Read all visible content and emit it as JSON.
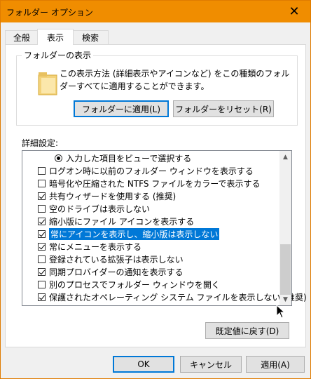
{
  "window": {
    "title": "フォルダー オプション",
    "close_glyph": "✕"
  },
  "tabs": [
    {
      "label": "全般"
    },
    {
      "label": "表示"
    },
    {
      "label": "検索"
    }
  ],
  "folder_view": {
    "legend": "フォルダーの表示",
    "description": "この表示方法 (詳細表示やアイコンなど) をこの種類のフォルダーすべてに適用することができます。",
    "apply_button": "フォルダーに適用(L)",
    "reset_button": "フォルダーをリセット(R)"
  },
  "advanced": {
    "label": "詳細設定:",
    "items": [
      {
        "type": "radio",
        "label": "入力した項目をビューで選択する",
        "checked": true
      },
      {
        "type": "checkbox",
        "label": "ログオン時に以前のフォルダー ウィンドウを表示する",
        "checked": false
      },
      {
        "type": "checkbox",
        "label": "暗号化や圧縮された NTFS ファイルをカラーで表示する",
        "checked": false
      },
      {
        "type": "checkbox",
        "label": "共有ウィザードを使用する (推奨)",
        "checked": true
      },
      {
        "type": "checkbox",
        "label": "空のドライブは表示しない",
        "checked": false
      },
      {
        "type": "checkbox",
        "label": "縮小版にファイル アイコンを表示する",
        "checked": true
      },
      {
        "type": "checkbox",
        "label": "常にアイコンを表示し、縮小版は表示しない",
        "checked": true,
        "selected": true
      },
      {
        "type": "checkbox",
        "label": "常にメニューを表示する",
        "checked": true
      },
      {
        "type": "checkbox",
        "label": "登録されている拡張子は表示しない",
        "checked": false
      },
      {
        "type": "checkbox",
        "label": "同期プロバイダーの通知を表示する",
        "checked": true
      },
      {
        "type": "checkbox",
        "label": "別のプロセスでフォルダー ウィンドウを開く",
        "checked": false
      },
      {
        "type": "checkbox",
        "label": "保護されたオペレーティング システム ファイルを表示しない (推奨)",
        "checked": true
      }
    ],
    "restore_defaults_button": "既定値に戻す(D)"
  },
  "footer": {
    "ok": "OK",
    "cancel": "キャンセル",
    "apply": "適用(A)"
  },
  "colors": {
    "titlebar": "#f08d00",
    "selection": "#0078d7"
  }
}
